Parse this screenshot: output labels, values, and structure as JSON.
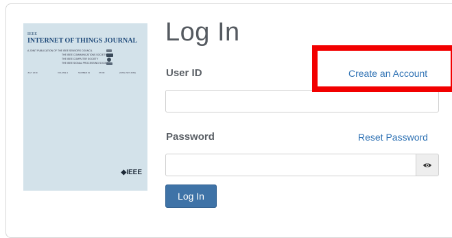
{
  "cover": {
    "ieee_small": "IEEE",
    "title": "INTERNET OF THINGS JOURNAL",
    "publication_line": "A JOINT PUBLICATION OF THE IEEE SENSORS COUNCIL",
    "societies": [
      "THE IEEE COMMUNICATIONS SOCIETY",
      "THE IEEE COMPUTER SOCIETY",
      "THE IEEE SIGNAL PROCESSING SOCIETY"
    ],
    "meta": [
      "JULY 2019",
      "VOLUME 1",
      "NUMBER 01",
      "IITJIM",
      "(ISSN 2327-4662)"
    ],
    "brand": "◆IEEE"
  },
  "login": {
    "heading": "Log In",
    "user_id_label": "User ID",
    "create_account_link": "Create an Account",
    "user_id_value": "",
    "password_label": "Password",
    "reset_password_link": "Reset Password",
    "password_value": "",
    "submit_label": "Log In",
    "show_password_icon": "eye-icon"
  },
  "annotation": {
    "highlight_color": "#f20000",
    "highlight_target": "create-account-link"
  },
  "colors": {
    "link": "#2f72b4",
    "button": "#3f73a7",
    "cover_background": "#d3e2ea"
  }
}
